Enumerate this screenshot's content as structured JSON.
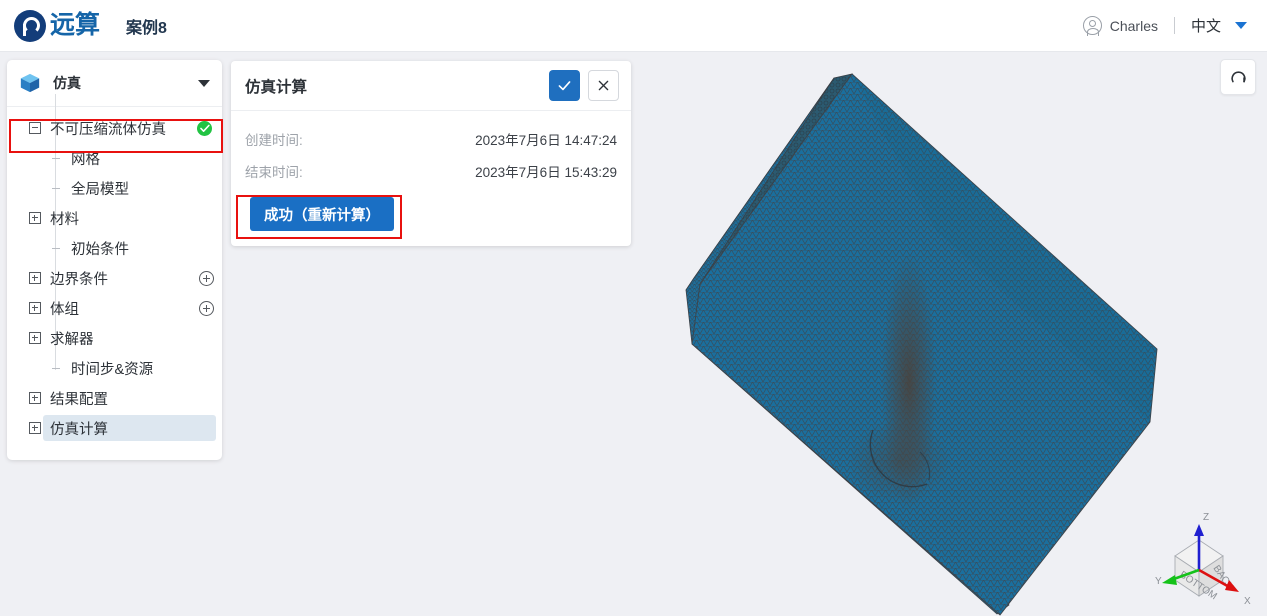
{
  "topbar": {
    "logo_text": "远算",
    "logo_icon": "yuansuan-logo-icon",
    "project_title": "案例8",
    "user_icon": "user-avatar-icon",
    "user_name": "Charles",
    "language": "中文",
    "language_caret_icon": "caret-down-icon",
    "accent_color": "#1a73d2"
  },
  "sidebar": {
    "header": {
      "icon": "cube-icon",
      "title": "仿真",
      "caret_icon": "caret-down-icon"
    },
    "tree": [
      {
        "label": "不可压缩流体仿真",
        "level": 0,
        "toggle": "minus",
        "badge": "check",
        "selected": false,
        "highlighted": true
      },
      {
        "label": "网格",
        "level": 1,
        "toggle": "leaf",
        "badge": "",
        "selected": false,
        "highlighted": false
      },
      {
        "label": "全局模型",
        "level": 1,
        "toggle": "leaf",
        "badge": "",
        "selected": false,
        "highlighted": false
      },
      {
        "label": "材料",
        "level": 0,
        "toggle": "plus",
        "badge": "",
        "selected": false,
        "highlighted": false
      },
      {
        "label": "初始条件",
        "level": 1,
        "toggle": "leaf",
        "badge": "",
        "selected": false,
        "highlighted": false
      },
      {
        "label": "边界条件",
        "level": 0,
        "toggle": "plus",
        "badge": "add",
        "selected": false,
        "highlighted": false
      },
      {
        "label": "体组",
        "level": 0,
        "toggle": "plus",
        "badge": "add",
        "selected": false,
        "highlighted": false
      },
      {
        "label": "求解器",
        "level": 0,
        "toggle": "plus",
        "badge": "",
        "selected": false,
        "highlighted": false
      },
      {
        "label": "时间步&资源",
        "level": 1,
        "toggle": "leaf",
        "badge": "",
        "selected": false,
        "highlighted": false
      },
      {
        "label": "结果配置",
        "level": 0,
        "toggle": "plus",
        "badge": "",
        "selected": false,
        "highlighted": false
      },
      {
        "label": "仿真计算",
        "level": 0,
        "toggle": "plus",
        "badge": "",
        "selected": true,
        "highlighted": false
      }
    ]
  },
  "dialog": {
    "title": "仿真计算",
    "confirm_icon": "check-icon",
    "cancel_icon": "close-icon",
    "rows": [
      {
        "key": "创建时间:",
        "value": "2023年7月6日 14:47:24"
      },
      {
        "key": "结束时间:",
        "value": "2023年7月6日 15:43:29"
      }
    ],
    "run_button_label": "成功（重新计算）",
    "run_button_color": "#1a6fc4"
  },
  "viewport": {
    "reset_icon": "reset-view-icon",
    "background_color": "#eff0f4",
    "mesh_color": "#1a6f9e",
    "axis_gizmo": {
      "z_label": "Z",
      "z_color": "#1f1fd0",
      "x_label": "X",
      "x_color": "#dd1010",
      "y_label": "Y",
      "y_color": "#15c21a",
      "cube_face_back": "BACK",
      "cube_face_bottom": "BOTTOM"
    }
  },
  "annotations": {
    "highlight_color": "#e8110f",
    "boxes": [
      "tree-item-incompressible",
      "run-simulation-button"
    ]
  }
}
